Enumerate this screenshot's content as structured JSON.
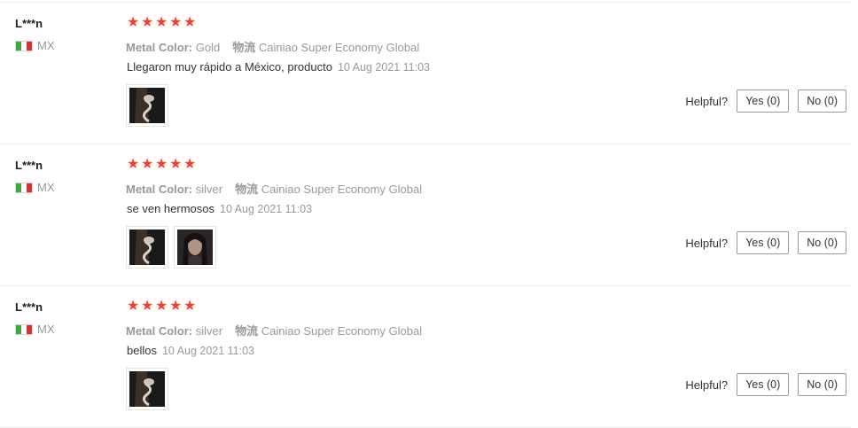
{
  "reviews": [
    {
      "user": "L***n",
      "country": "MX",
      "rating": 5,
      "metal_label": "Metal Color:",
      "metal_value": "Gold",
      "shipping_label": "物流",
      "shipping_value": "Cainiao Super Economy Global",
      "text": "Llegaron muy rápido a México, producto",
      "date": "10 Aug 2021 11:03",
      "photos": [
        "earring-photo"
      ],
      "helpful_label": "Helpful?",
      "yes_label": "Yes (0)",
      "no_label": "No (0)"
    },
    {
      "user": "L***n",
      "country": "MX",
      "rating": 5,
      "metal_label": "Metal Color:",
      "metal_value": "silver",
      "shipping_label": "物流",
      "shipping_value": "Cainiao Super Economy Global",
      "text": "se ven hermosos",
      "date": "10 Aug 2021 11:03",
      "photos": [
        "earring-photo",
        "portrait-photo"
      ],
      "helpful_label": "Helpful?",
      "yes_label": "Yes (0)",
      "no_label": "No (0)"
    },
    {
      "user": "L***n",
      "country": "MX",
      "rating": 5,
      "metal_label": "Metal Color:",
      "metal_value": "silver",
      "shipping_label": "物流",
      "shipping_value": "Cainiao Super Economy Global",
      "text": "bellos",
      "date": "10 Aug 2021 11:03",
      "photos": [
        "earring-photo"
      ],
      "helpful_label": "Helpful?",
      "yes_label": "Yes (0)",
      "no_label": "No (0)"
    }
  ],
  "colors": {
    "star": "#f0412b",
    "flag_green": "#3aa843",
    "flag_red": "#d9322c"
  }
}
